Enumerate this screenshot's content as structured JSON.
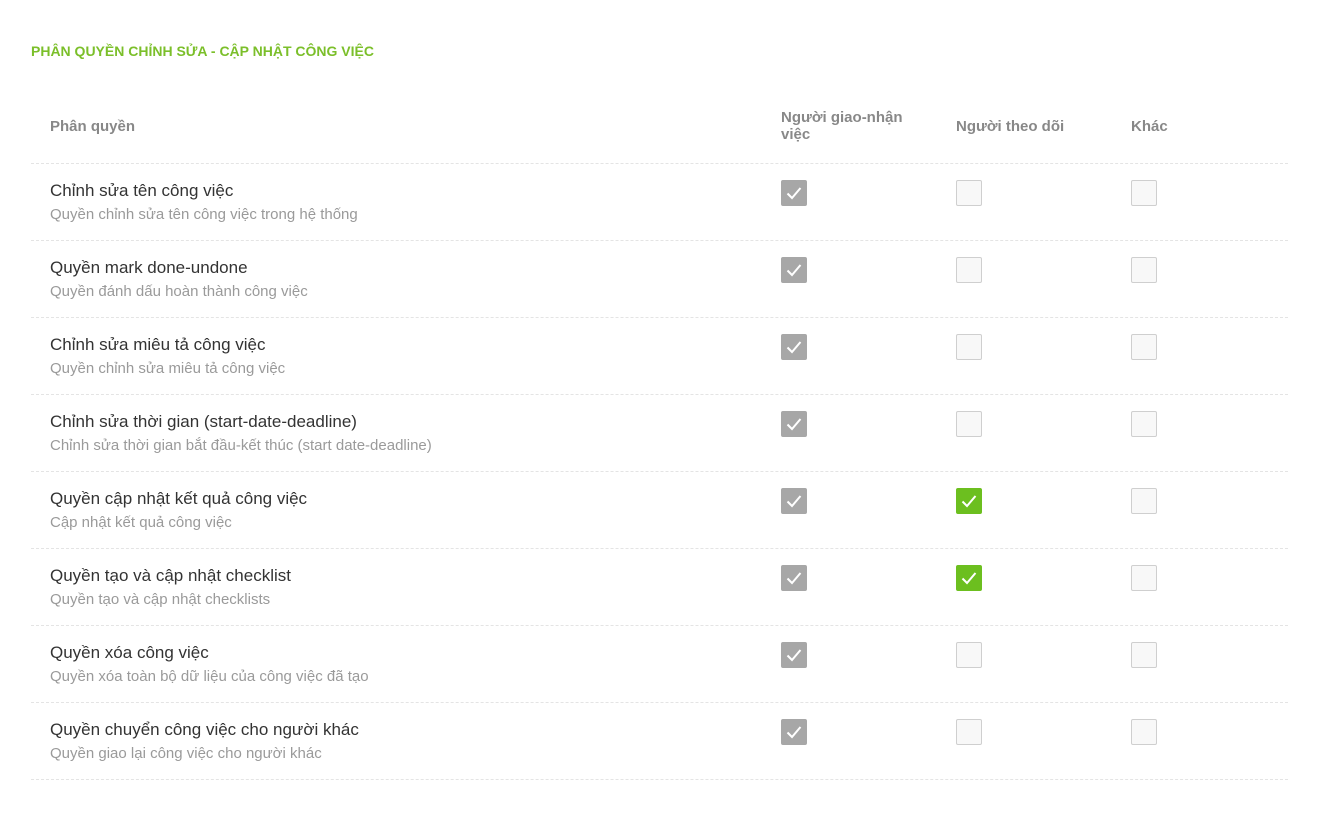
{
  "section": {
    "title": "PHÂN QUYỀN CHỈNH SỬA - CẬP NHẬT CÔNG VIỆC"
  },
  "columns": {
    "permission": "Phân quyền",
    "assignee": "Người giao-nhận việc",
    "follower": "Người theo dõi",
    "other": "Khác"
  },
  "colors": {
    "accent_green": "#6cbf1f",
    "title_green": "#7bbf2a",
    "checked_gray": "#a7a7a7"
  },
  "rows": [
    {
      "title": "Chỉnh sửa tên công việc",
      "desc": "Quyền chỉnh sửa tên công việc trong hệ thống",
      "assignee": "checked-disabled",
      "follower": "unchecked",
      "other": "unchecked"
    },
    {
      "title": "Quyền mark done-undone",
      "desc": "Quyền đánh dấu hoàn thành công việc",
      "assignee": "checked-disabled",
      "follower": "unchecked",
      "other": "unchecked"
    },
    {
      "title": "Chỉnh sửa miêu tả công việc",
      "desc": "Quyền chỉnh sửa miêu tả công việc",
      "assignee": "checked-disabled",
      "follower": "unchecked",
      "other": "unchecked"
    },
    {
      "title": "Chỉnh sửa thời gian (start-date-deadline)",
      "desc": "Chỉnh sửa thời gian bắt đầu-kết thúc (start date-deadline)",
      "assignee": "checked-disabled",
      "follower": "unchecked",
      "other": "unchecked"
    },
    {
      "title": "Quyền cập nhật kết quả công việc",
      "desc": "Cập nhật kết quả công việc",
      "assignee": "checked-disabled",
      "follower": "checked",
      "other": "unchecked"
    },
    {
      "title": "Quyền tạo và cập nhật checklist",
      "desc": "Quyền tạo và cập nhật checklists",
      "assignee": "checked-disabled",
      "follower": "checked",
      "other": "unchecked"
    },
    {
      "title": "Quyền xóa công việc",
      "desc": "Quyền xóa toàn bộ dữ liệu của công việc đã tạo",
      "assignee": "checked-disabled",
      "follower": "unchecked",
      "other": "unchecked"
    },
    {
      "title": "Quyền chuyển công việc cho người khác",
      "desc": "Quyền giao lại công việc cho người khác",
      "assignee": "checked-disabled",
      "follower": "unchecked",
      "other": "unchecked"
    }
  ]
}
